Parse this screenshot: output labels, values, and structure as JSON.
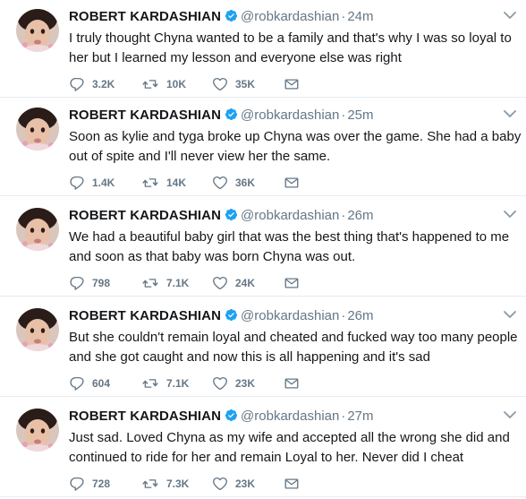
{
  "tweets": [
    {
      "name": "ROBERT KARDASHIAN",
      "handle": "@robkardashian",
      "separator": "·",
      "time": "24m",
      "text": "I truly thought Chyna wanted to be a family and that's why I was so loyal to her but I learned my lesson and everyone else was right",
      "replies": "3.2K",
      "retweets": "10K",
      "likes": "35K"
    },
    {
      "name": "ROBERT KARDASHIAN",
      "handle": "@robkardashian",
      "separator": "·",
      "time": "25m",
      "text": "Soon as kylie and tyga broke up Chyna was over the game. She had a baby out of spite and I'll never view her the same.",
      "replies": "1.4K",
      "retweets": "14K",
      "likes": "36K"
    },
    {
      "name": "ROBERT KARDASHIAN",
      "handle": "@robkardashian",
      "separator": "·",
      "time": "26m",
      "text": "We had a beautiful baby girl that was the best thing that's happened to me and soon as that baby was born Chyna was out.",
      "replies": "798",
      "retweets": "7.1K",
      "likes": "24K"
    },
    {
      "name": "ROBERT KARDASHIAN",
      "handle": "@robkardashian",
      "separator": "·",
      "time": "26m",
      "text": "But she couldn't remain loyal and cheated and fucked way too many people and she got caught and now this is all happening and it's sad",
      "replies": "604",
      "retweets": "7.1K",
      "likes": "23K"
    },
    {
      "name": "ROBERT KARDASHIAN",
      "handle": "@robkardashian",
      "separator": "·",
      "time": "27m",
      "text": "Just sad. Loved Chyna as my wife and accepted all the wrong she did and continued to ride for her and remain Loyal to her. Never did I cheat",
      "replies": "728",
      "retweets": "7.3K",
      "likes": "23K"
    }
  ],
  "icons": {
    "verified": "verified-badge-icon",
    "caret": "chevron-down-icon",
    "reply": "reply-icon",
    "retweet": "retweet-icon",
    "like": "heart-icon",
    "dm": "envelope-icon"
  },
  "colors": {
    "name": "#14171a",
    "meta": "#657786",
    "verified": "#1da1f2",
    "divider": "#e6ecf0"
  }
}
